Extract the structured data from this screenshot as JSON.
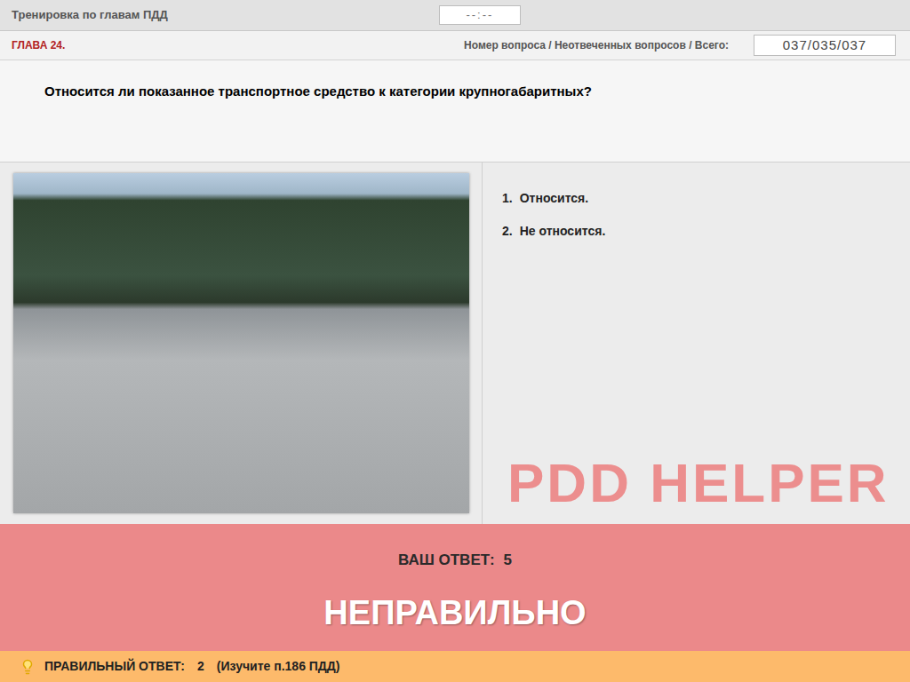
{
  "header": {
    "title": "Тренировка по главам ПДД",
    "timer": "--:--"
  },
  "chapter": "ГЛАВА 24.",
  "counter": {
    "label": "Номер вопроса / Неотвеченных вопросов / Всего:",
    "value": "037/035/037"
  },
  "question": "Относится ли показанное транспортное средство к категории крупногабаритных?",
  "answers": [
    {
      "number": "1.",
      "text": "Относится.",
      "selected": false
    },
    {
      "number": "2.",
      "text": "Не относится.",
      "selected": false
    }
  ],
  "watermark": "PDD HELPER",
  "result": {
    "label": "ВАШ ОТВЕТ:",
    "answer": "5",
    "verdict": "НЕПРАВИЛЬНО"
  },
  "hint": {
    "label": "ПРАВИЛЬНЫЙ ОТВЕТ:",
    "answer": "2",
    "reference": "(Изучите п.186 ПДД)"
  }
}
